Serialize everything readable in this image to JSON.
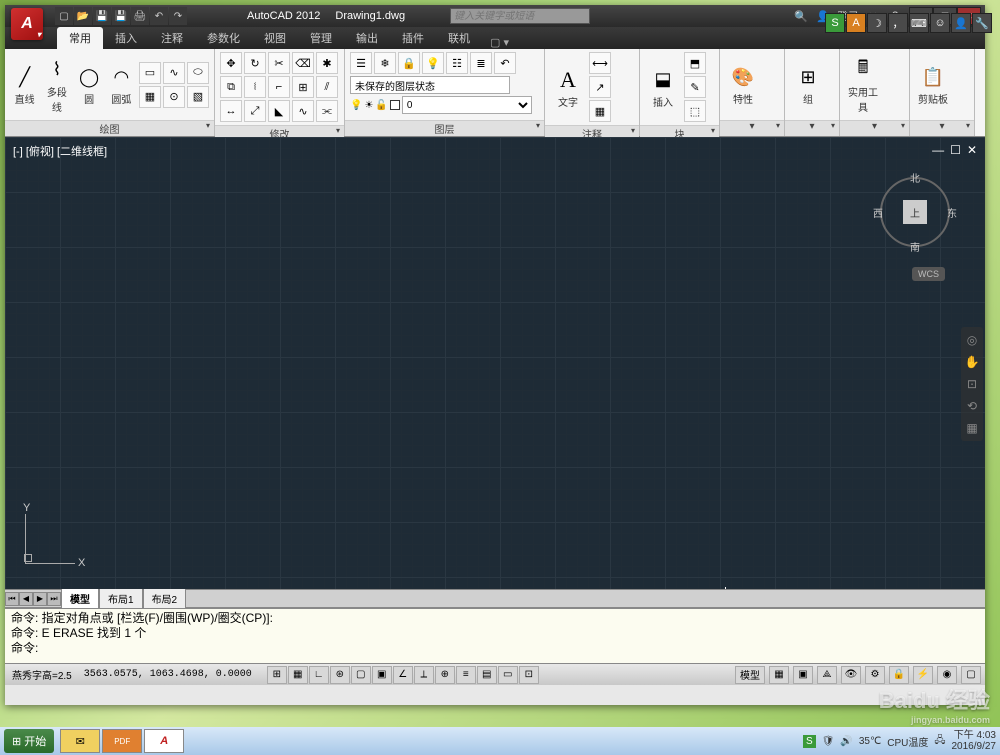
{
  "app": {
    "letter": "A",
    "title": "AutoCAD 2012",
    "filename": "Drawing1.dwg"
  },
  "searchPlaceholder": "键入关键字或短语",
  "login": "登录",
  "tabs": [
    "常用",
    "插入",
    "注释",
    "参数化",
    "视图",
    "管理",
    "输出",
    "插件",
    "联机"
  ],
  "ribbon": {
    "draw": {
      "title": "绘图",
      "buttons": [
        "直线",
        "多段线",
        "圆",
        "圆弧"
      ]
    },
    "modify": {
      "title": "修改"
    },
    "layer": {
      "title": "图层",
      "state": "未保存的图层状态",
      "current": "0"
    },
    "text": {
      "title": "注释",
      "label": "文字"
    },
    "insert": {
      "title": "块",
      "label": "插入"
    },
    "props": {
      "title": "特性"
    },
    "group": {
      "title": "组"
    },
    "utils": {
      "title": "实用工具"
    },
    "clip": {
      "title": "剪贴板"
    }
  },
  "viewport": {
    "label": "[-] [俯视] [二维线框]",
    "compass": {
      "n": "北",
      "s": "南",
      "w": "西",
      "e": "东",
      "face": "上"
    },
    "wcs": "WCS",
    "axes": {
      "x": "X",
      "y": "Y"
    }
  },
  "layoutTabs": [
    "模型",
    "布局1",
    "布局2"
  ],
  "command": {
    "line1": "命令: 指定对角点或 [栏选(F)/圈围(WP)/圈交(CP)]:",
    "line2": "命令: E ERASE 找到 1 个",
    "line3": "",
    "prompt": "命令:"
  },
  "status": {
    "textHeight": "燕秀字高=2.5",
    "coords": "3563.0575, 1063.4698, 0.0000",
    "modelBtn": "模型",
    "cpuTemp": "CPU温度",
    "temp": "35℃"
  },
  "taskbar": {
    "start": "开始",
    "temp": "35℃",
    "cpuLabel": "CPU温度",
    "time": "下午 4:03",
    "date": "2016/9/27"
  },
  "overlay": {
    "s": "S",
    "a": "A",
    "watermark": "Baidu 经验",
    "watermarkSub": "jingyan.baidu.com"
  }
}
